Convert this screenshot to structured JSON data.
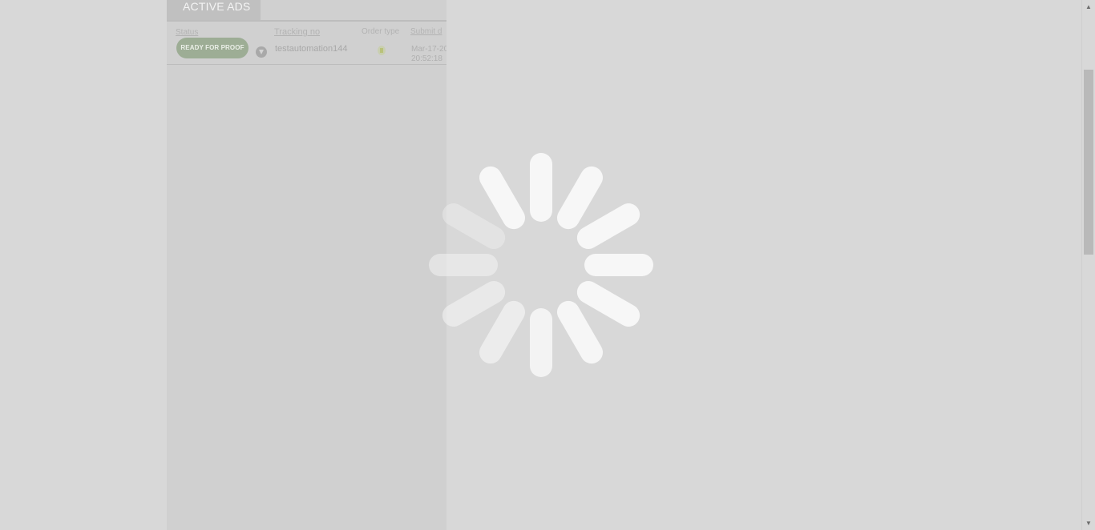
{
  "tabs": {
    "active_ads": "ACTIVE ADS"
  },
  "table": {
    "headers": {
      "status": "Status",
      "tracking_no": "Tracking no",
      "order_type": "Order type",
      "submit_date": "Submit d"
    },
    "rows": [
      {
        "status": "READY FOR PROOF",
        "tracking_no": "testautomation144",
        "order_type_icon": "document-icon",
        "submit_date_line1": "Mar-17-20",
        "submit_date_line2": "20:52:18"
      }
    ]
  },
  "overlay": {
    "state": "loading",
    "spinner_icon": "loading-spinner-icon"
  },
  "scrollbar": {
    "up_glyph": "▲",
    "down_glyph": "▼"
  },
  "colors": {
    "background": "#d8d8d8",
    "panel": "#d0d0d0",
    "status_badge": "#9dad95",
    "spinner": "#fafafa"
  }
}
